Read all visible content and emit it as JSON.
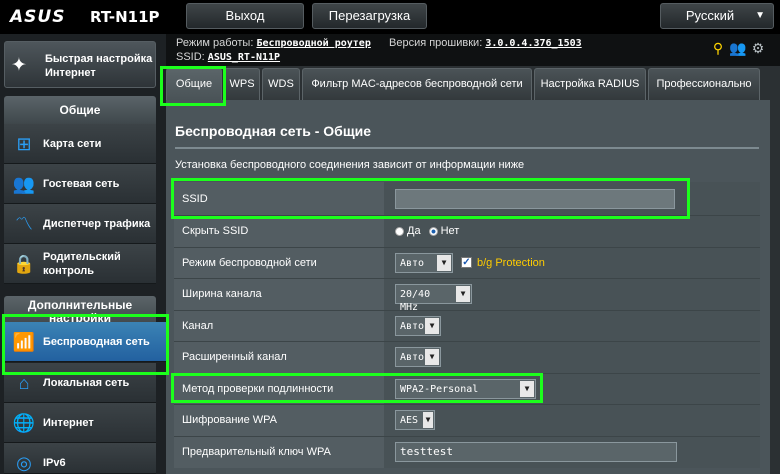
{
  "header": {
    "logo": "ASUS",
    "model": "RT-N11P",
    "logout": "Выход",
    "reboot": "Перезагрузка",
    "language": "Русский"
  },
  "info": {
    "mode_label": "Режим работы:",
    "mode_value": "Беспроводной роутер",
    "fw_label": "Версия прошивки:",
    "fw_value": "3.0.0.4.376_1503",
    "ssid_label": "SSID:",
    "ssid_value": "ASUS_RT-N11P"
  },
  "sidebar": {
    "quick_setup": "Быстрая настройка Интернет",
    "general_section": "Общие",
    "items": [
      {
        "label": "Карта сети",
        "icon": "network-map-icon"
      },
      {
        "label": "Гостевая сеть",
        "icon": "guest-network-icon"
      },
      {
        "label": "Диспетчер трафика",
        "icon": "traffic-manager-icon"
      },
      {
        "label": "Родительский контроль",
        "icon": "parental-control-icon"
      }
    ],
    "advanced_section": "Дополнительные настройки",
    "adv_items": [
      {
        "label": "Беспроводная сеть",
        "icon": "wifi-icon"
      },
      {
        "label": "Локальная сеть",
        "icon": "home-icon"
      },
      {
        "label": "Интернет",
        "icon": "globe-icon"
      },
      {
        "label": "IPv6",
        "icon": "ipv6-icon"
      }
    ]
  },
  "tabs": [
    {
      "label": "Общие"
    },
    {
      "label": "WPS"
    },
    {
      "label": "WDS"
    },
    {
      "label": "Фильтр MAC-адресов беспроводной сети"
    },
    {
      "label": "Настройка RADIUS"
    },
    {
      "label": "Профессионально"
    }
  ],
  "main": {
    "title": "Беспроводная сеть - Общие",
    "description": "Установка беспроводного соединения зависит от информации ниже",
    "ssid_label": "SSID",
    "ssid_value": "",
    "hide_ssid_label": "Скрыть SSID",
    "hide_ssid_yes": "Да",
    "hide_ssid_no": "Нет",
    "mode_label": "Режим беспроводной сети",
    "mode_value": "Авто",
    "bg_protection": "b/g Protection",
    "width_label": "Ширина канала",
    "width_value": "20/40 MHz",
    "channel_label": "Канал",
    "channel_value": "Авто",
    "ext_channel_label": "Расширенный канал",
    "ext_channel_value": "Авто",
    "auth_label": "Метод проверки подлинности",
    "auth_value": "WPA2-Personal",
    "wpa_enc_label": "Шифрование WPA",
    "wpa_enc_value": "AES",
    "psk_label": "Предварительный ключ WPA",
    "psk_value": "testtest"
  },
  "colors": {
    "highlight": "#1cff1c",
    "active_nav": "#2a6aa6",
    "accent_yellow": "#ffcc00"
  }
}
